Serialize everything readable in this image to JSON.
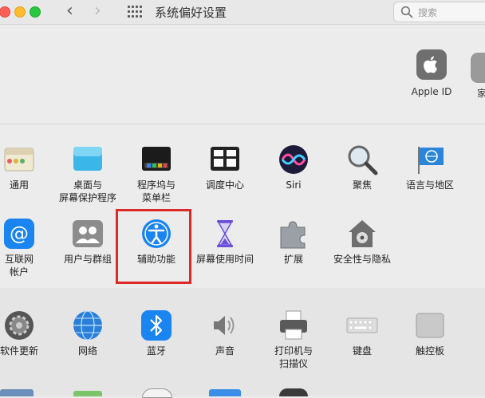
{
  "window": {
    "title": "系统偏好设置",
    "search_placeholder": "搜索"
  },
  "account": {
    "apple_id_label": "Apple ID",
    "family_label": "家"
  },
  "row1": [
    {
      "label": "通用"
    },
    {
      "label": "桌面与\n屏幕保护程序"
    },
    {
      "label": "程序坞与\n菜单栏"
    },
    {
      "label": "调度中心"
    },
    {
      "label": "Siri"
    },
    {
      "label": "聚焦"
    },
    {
      "label": "语言与地区"
    }
  ],
  "row2": [
    {
      "label": "互联网\n帐户"
    },
    {
      "label": "用户与群组"
    },
    {
      "label": "辅助功能"
    },
    {
      "label": "屏幕使用时间"
    },
    {
      "label": "扩展"
    },
    {
      "label": "安全性与隐私"
    }
  ],
  "row3": [
    {
      "label": "软件更新"
    },
    {
      "label": "网络"
    },
    {
      "label": "蓝牙"
    },
    {
      "label": "声音"
    },
    {
      "label": "打印机与\n扫描仪"
    },
    {
      "label": "键盘"
    },
    {
      "label": "触控板"
    }
  ],
  "colors": {
    "highlight": "#dd2a28",
    "accent_blue": "#1a84f0"
  }
}
